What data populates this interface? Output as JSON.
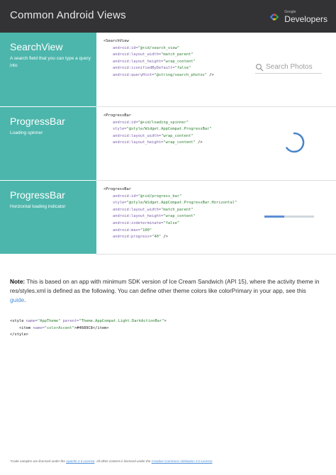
{
  "header": {
    "title": "Common Android Views",
    "brand_small": "Google",
    "brand_big": "Developers"
  },
  "sections": [
    {
      "title": "SearchView",
      "description": "A search field that you can type a query into",
      "code": [
        [
          {
            "t": "<SearchView"
          }
        ],
        [
          {
            "t": "    "
          },
          {
            "c": "attr",
            "t": "android:id="
          },
          {
            "c": "val",
            "t": "\"@+id/search_view\""
          }
        ],
        [
          {
            "t": "    "
          },
          {
            "c": "attr",
            "t": "android:layout_width="
          },
          {
            "c": "val",
            "t": "\"match_parent\""
          }
        ],
        [
          {
            "t": "    "
          },
          {
            "c": "attr",
            "t": "android:layout_height="
          },
          {
            "c": "val",
            "t": "\"wrap_content\""
          }
        ],
        [
          {
            "t": "    "
          },
          {
            "c": "attr",
            "t": "android:iconifiedByDefault="
          },
          {
            "c": "val",
            "t": "\"false\""
          }
        ],
        [
          {
            "t": "    "
          },
          {
            "c": "attr",
            "t": "android:queryHint="
          },
          {
            "c": "val",
            "t": "\"@string/search_photos\""
          },
          {
            "t": " />"
          }
        ]
      ]
    },
    {
      "title": "ProgressBar",
      "description": "Loading spinner",
      "code": [
        [
          {
            "t": "<ProgressBar"
          }
        ],
        [
          {
            "t": "    "
          },
          {
            "c": "attr",
            "t": "android:id="
          },
          {
            "c": "val",
            "t": "\"@+id/loading_spinner\""
          }
        ],
        [
          {
            "t": "    "
          },
          {
            "c": "attr",
            "t": "style="
          },
          {
            "c": "val",
            "t": "\"@style/Widget.AppCompat.ProgressBar\""
          }
        ],
        [
          {
            "t": "    "
          },
          {
            "c": "attr",
            "t": "android:layout_width="
          },
          {
            "c": "val",
            "t": "\"wrap_content\""
          }
        ],
        [
          {
            "t": "    "
          },
          {
            "c": "attr",
            "t": "android:layout_height="
          },
          {
            "c": "val",
            "t": "\"wrap_content\""
          },
          {
            "t": " />"
          }
        ]
      ]
    },
    {
      "title": "ProgressBar",
      "description": "Horizontal loading indicator",
      "code": [
        [
          {
            "t": "<ProgressBar"
          }
        ],
        [
          {
            "t": "    "
          },
          {
            "c": "attr",
            "t": "android:id="
          },
          {
            "c": "val",
            "t": "\"@+id/progress_bar\""
          }
        ],
        [
          {
            "t": "    "
          },
          {
            "c": "attr",
            "t": "style="
          },
          {
            "c": "val",
            "t": "\"@style/Widget.AppCompat.ProgressBar.Horizontal\""
          }
        ],
        [
          {
            "t": "    "
          },
          {
            "c": "attr",
            "t": "android:layout_width="
          },
          {
            "c": "val",
            "t": "\"match_parent\""
          }
        ],
        [
          {
            "t": "    "
          },
          {
            "c": "attr",
            "t": "android:layout_height="
          },
          {
            "c": "val",
            "t": "\"wrap_content\""
          }
        ],
        [
          {
            "t": "    "
          },
          {
            "c": "attr",
            "t": "android:indeterminate="
          },
          {
            "c": "val",
            "t": "\"false\""
          }
        ],
        [
          {
            "t": "    "
          },
          {
            "c": "attr",
            "t": "android:max="
          },
          {
            "c": "val",
            "t": "\"100\""
          }
        ],
        [
          {
            "t": "    "
          },
          {
            "c": "attr",
            "t": "android:progress="
          },
          {
            "c": "val",
            "t": "\"40\""
          },
          {
            "t": " />"
          }
        ]
      ]
    }
  ],
  "demo": {
    "search_placeholder": "Search Photos",
    "search_icon": "search-icon",
    "spinner_icon": "progress-spinner-icon",
    "progress_value": 40,
    "progress_max": 100
  },
  "note": {
    "label": "Note:",
    "text": " This is based on an app with minimum SDK version of Ice Cream Sandwich (API 15), where the activity theme in res/styles.xml is defined as the following. You can define other theme colors like colorPrimary in your app, see this ",
    "link": "guide",
    "end": "."
  },
  "theme_code": [
    [
      {
        "t": "<style "
      },
      {
        "c": "attr",
        "t": "name="
      },
      {
        "c": "val",
        "t": "\"AppTheme\""
      },
      {
        "t": " "
      },
      {
        "c": "attr",
        "t": "parent="
      },
      {
        "c": "val",
        "t": "\"Theme.AppCompat.Light.DarkActionBar\""
      },
      {
        "t": ">"
      }
    ],
    [
      {
        "t": "    <item "
      },
      {
        "c": "attr",
        "t": "name="
      },
      {
        "c": "val",
        "t": "\"colorAccent\""
      },
      {
        "t": ">#4689C8</item>"
      }
    ],
    [
      {
        "t": "</style>"
      }
    ]
  ],
  "footer": {
    "text1": "*Code samples are licensed under the ",
    "link1": "Apache 2.0 License",
    "text2": ". All other content is licensed under the ",
    "link2": "Creative Commons Attribution 3.0 License"
  },
  "colors": {
    "header_bg": "#333335",
    "teal": "#4db6ac",
    "accent": "#4689C8"
  }
}
